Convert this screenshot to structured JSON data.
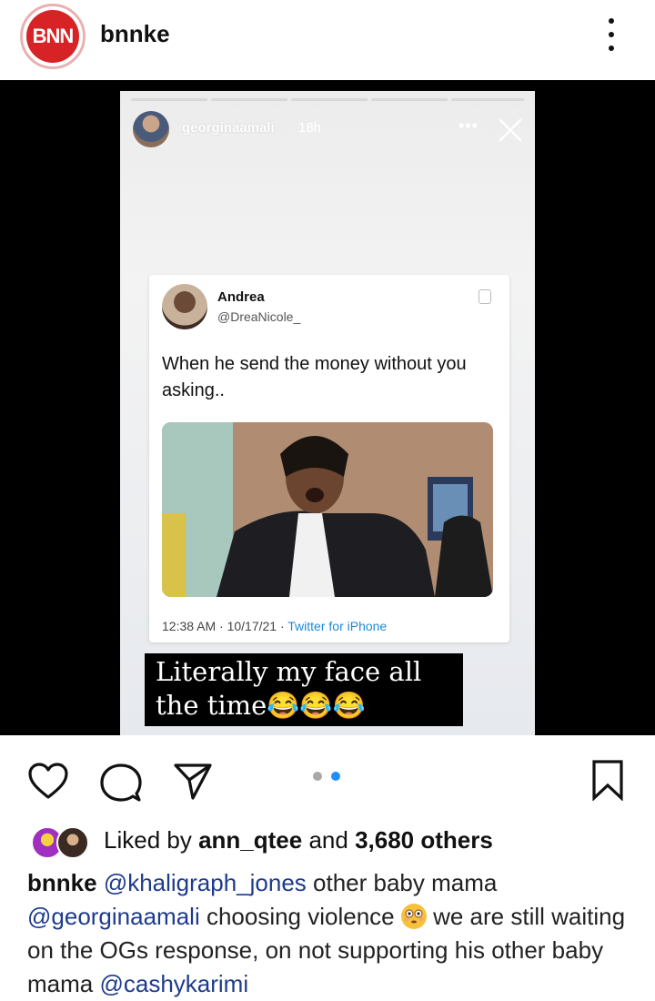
{
  "header": {
    "logo_text": "BNN",
    "username": "bnnke"
  },
  "story": {
    "username": "georginaamali",
    "time": "18h",
    "more": "•••"
  },
  "tweet": {
    "name": "Andrea",
    "handle": "@DreaNicole_",
    "text": "When he send the money without you asking..",
    "time": "12:38 AM · 10/17/21 · ",
    "source": "Twitter for iPhone"
  },
  "story_caption": "Literally my face all the time😂😂😂",
  "likes": {
    "prefix": "Liked by ",
    "user": "ann_qtee",
    "middle": " and ",
    "count": "3,680 others"
  },
  "post": {
    "username": "bnnke",
    "mention1": "@khaligraph_jones",
    "text1": " other baby mama ",
    "mention2": "@georginaamali",
    "text2": " choosing violence ",
    "emoji": "😳",
    "text3": " we are still waiting on the OGs response, on not supporting his other baby mama ",
    "mention3": "@cashykarimi"
  },
  "carousel": {
    "count": 2,
    "active": 2
  },
  "colors": {
    "mention": "#1e3b8c",
    "brand_red": "#d72326",
    "carousel_active": "#1e90ff"
  },
  "icons": [
    "more-vert-icon",
    "close-icon",
    "heart-icon",
    "comment-icon",
    "share-icon",
    "bookmark-icon"
  ]
}
